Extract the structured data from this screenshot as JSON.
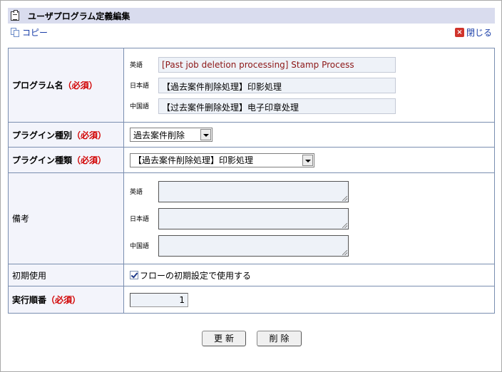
{
  "header": {
    "title": "ユーザプログラム定義編集",
    "icon": "clipboard-icon"
  },
  "toolbar": {
    "copy_label": "コピー",
    "close_label": "閉じる"
  },
  "form": {
    "program_name": {
      "label": "プログラム名",
      "required": "（必須）",
      "langs": [
        {
          "lang": "英語",
          "value": "[Past job deletion processing] Stamp Process"
        },
        {
          "lang": "日本語",
          "value": "【過去案件削除処理】印影処理"
        },
        {
          "lang": "中国語",
          "value": "【过去案件删除处理】电子印章处理"
        }
      ]
    },
    "plugin_type": {
      "label": "プラグイン種別",
      "required": "（必須）",
      "selected": "過去案件削除"
    },
    "plugin_kind": {
      "label": "プラグイン種類",
      "required": "（必須）",
      "selected": "【過去案件削除処理】印影処理"
    },
    "notes": {
      "label": "備考",
      "langs": [
        {
          "lang": "英語",
          "value": ""
        },
        {
          "lang": "日本語",
          "value": ""
        },
        {
          "lang": "中国語",
          "value": ""
        }
      ]
    },
    "initial_use": {
      "label": "初期使用",
      "checkbox_label": "フローの初期設定で使用する",
      "checked": true
    },
    "exec_order": {
      "label": "実行順番",
      "required": "（必須）",
      "value": "1"
    }
  },
  "buttons": {
    "update": "更新",
    "delete": "削除"
  }
}
